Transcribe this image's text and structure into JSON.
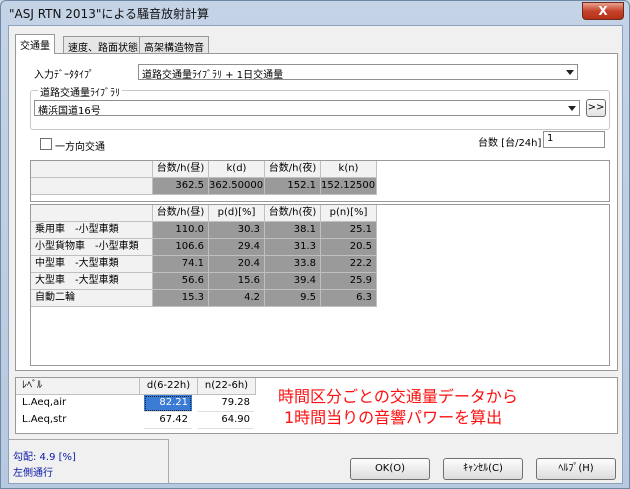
{
  "window": {
    "title": "\"ASJ RTN 2013\"による騒音放射計算",
    "close_label": "X"
  },
  "tabs": [
    {
      "label": "交通量"
    },
    {
      "label": "速度、路面状態"
    },
    {
      "label": "高架構造物音"
    }
  ],
  "input_data_type": {
    "label": "入力ﾃﾞｰﾀﾀｲﾌﾟ",
    "value": "道路交通量ﾗｲﾌﾞﾗﾘ + 1日交通量"
  },
  "library": {
    "group_label": "道路交通量ﾗｲﾌﾞﾗﾘ",
    "value": "横浜国道16号",
    "expand_label": ">>"
  },
  "one_way": {
    "label": "一方向交通"
  },
  "vehicle_count": {
    "label": "台数 [台/24h]",
    "value": "1"
  },
  "summary_table": {
    "headers": [
      "台数/h(昼)",
      "k(d)",
      "台数/h(夜)",
      "k(n)"
    ],
    "values": [
      "362.5",
      "362.50000",
      "152.1",
      "152.12500"
    ]
  },
  "class_table": {
    "headers": [
      "台数/h(昼)",
      "p(d)[%]",
      "台数/h(夜)",
      "p(n)[%]"
    ],
    "rows": [
      {
        "label": "乗用車　-小型車類",
        "values": [
          "110.0",
          "30.3",
          "38.1",
          "25.1"
        ]
      },
      {
        "label": "小型貨物車　-小型車類",
        "values": [
          "106.6",
          "29.4",
          "31.3",
          "20.5"
        ]
      },
      {
        "label": "中型車　-大型車類",
        "values": [
          "74.1",
          "20.4",
          "33.8",
          "22.2"
        ]
      },
      {
        "label": "大型車　-大型車類",
        "values": [
          "56.6",
          "15.6",
          "39.4",
          "25.9"
        ]
      },
      {
        "label": "自動二輪",
        "values": [
          "15.3",
          "4.2",
          "9.5",
          "6.3"
        ]
      }
    ]
  },
  "level_table": {
    "headers": [
      "ﾚﾍﾞﾙ",
      "d(6-22h)",
      "n(22-6h)"
    ],
    "rows": [
      {
        "label": "L.Aeq,air",
        "values": [
          "82.21",
          "79.28"
        ]
      },
      {
        "label": "L.Aeq,str",
        "values": [
          "67.42",
          "64.90"
        ]
      }
    ]
  },
  "annotation": {
    "line1": "時間区分ごとの交通量データから",
    "line2": "1時間当りの音響パワーを算出"
  },
  "status": {
    "gradient": "勾配: 4.9 [%]",
    "side": "左側通行"
  },
  "buttons": {
    "ok": "OK(O)",
    "cancel": "ｷｬﾝｾﾙ(C)",
    "help": "ﾍﾙﾌﾟ(H)"
  }
}
